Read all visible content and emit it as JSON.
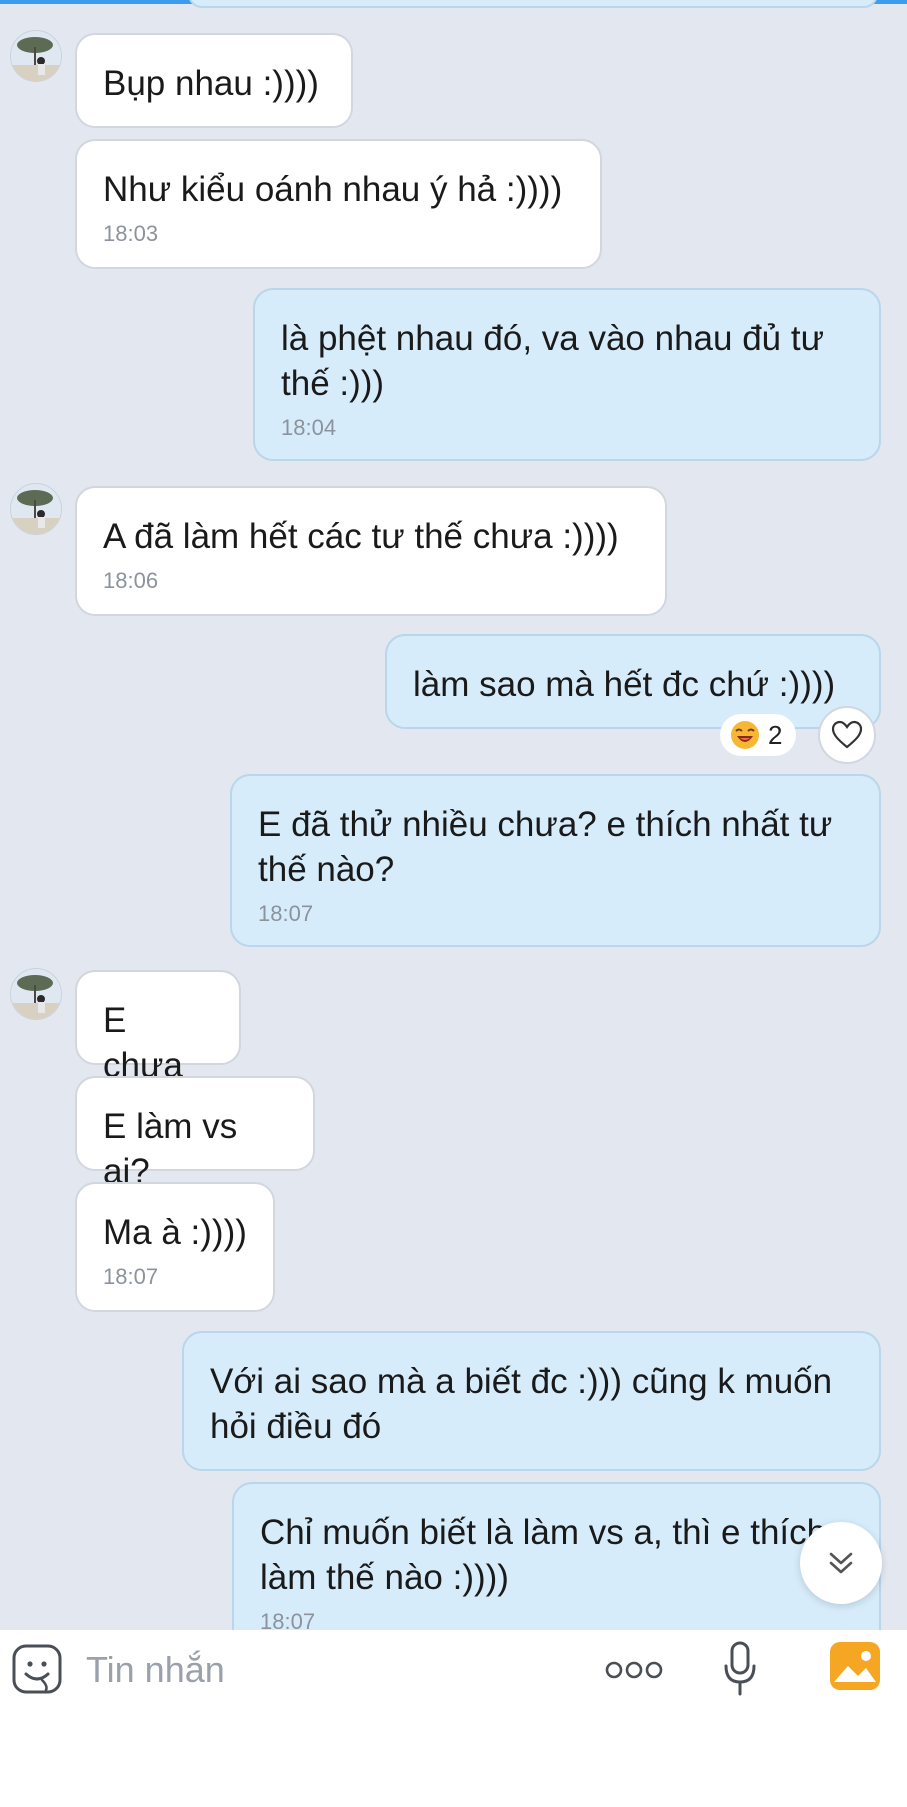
{
  "messages": [
    {
      "text": "Bụp nhau :))))",
      "time": ""
    },
    {
      "text": "Như kiểu oánh nhau ý hả :))))",
      "time": "18:03"
    },
    {
      "text": "là phệt nhau đó, va vào nhau đủ tư thế :)))",
      "time": "18:04"
    },
    {
      "text": "A đã làm hết các tư thế chưa :))))",
      "time": "18:06"
    },
    {
      "text": "làm sao mà hết đc chứ :))))",
      "time": ""
    },
    {
      "text": "E đã thử nhiều chưa? e thích nhất tư thế nào?",
      "time": "18:07"
    },
    {
      "text": "E chưa",
      "time": ""
    },
    {
      "text": "E làm vs ai?",
      "time": ""
    },
    {
      "text": "Ma à :))))",
      "time": "18:07"
    },
    {
      "text": "Với ai sao mà a biết đc :))) cũng k muốn hỏi điều đó",
      "time": ""
    },
    {
      "text": "Chỉ muốn biết là làm vs a, thì e thích làm thế nào :))))",
      "time": "18:07"
    }
  ],
  "reaction": {
    "count": "2"
  },
  "input": {
    "placeholder": "Tin nhắn"
  },
  "icons": {
    "sticker": "sticker-icon",
    "more": "more-icon",
    "mic": "microphone-icon",
    "gallery": "gallery-icon",
    "heart": "heart-icon",
    "scroll": "chevron-double-down-icon",
    "reaction_emoji": "laughing-emoji-icon"
  },
  "colors": {
    "background": "#e3e7ef",
    "incoming_bubble": "#ffffff",
    "outgoing_bubble": "#d6ecfb",
    "accent": "#3d9cf0",
    "gallery_orange": "#f5a623"
  }
}
